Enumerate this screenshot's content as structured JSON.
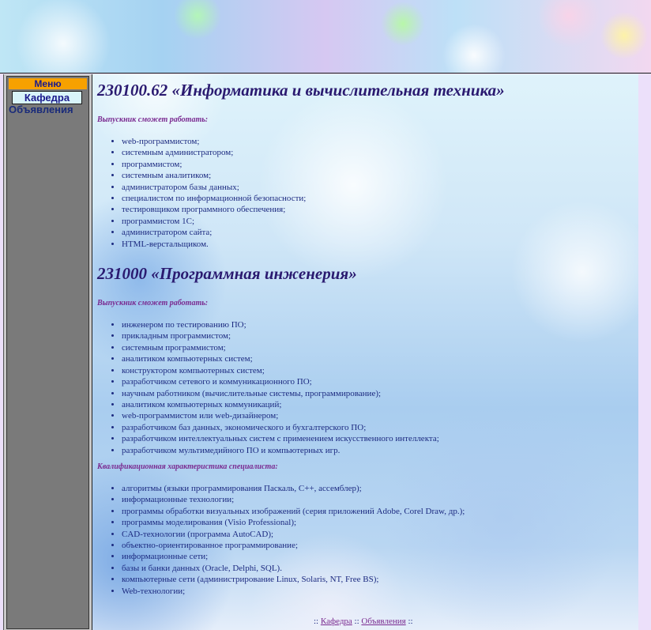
{
  "menu": {
    "title": "Меню",
    "items": [
      {
        "label": "Кафедра"
      },
      {
        "label": "Объявления"
      }
    ]
  },
  "sections": [
    {
      "heading": "230100.62 «Информатика и вычислительная техника»",
      "subheading": "Выпускник сможет работать:",
      "items": [
        "web-программистом;",
        "системным администратором;",
        "программистом;",
        "системным аналитиком;",
        "администратором базы данных;",
        "специалистом по информационной безопасности;",
        "тестировщиком программного обеспечения;",
        "программистом 1С;",
        "администратором сайта;",
        "HTML-верстальщиком."
      ]
    },
    {
      "heading": "231000 «Программная инженерия»",
      "subheading": "Выпускник сможет работать:",
      "items": [
        "инженером по тестированию ПО;",
        "прикладным программистом;",
        "системным программистом;",
        "аналитиком компьютерных систем;",
        "конструктором компьютерных систем;",
        "разработчиком сетевого и коммуникационного ПО;",
        "научным работником (вычислительные системы, программирование);",
        "аналитиком компьютерных коммуникаций;",
        "web-программистом или web-дизайнером;",
        "разработчиком баз данных, экономического и бухгалтерского ПО;",
        "разработчиком интеллектуальных систем с применением искусственного интеллекта;",
        "разработчиком мультимедийного ПО и компьютерных игр."
      ],
      "qualification_heading": "Квалификационная характеристика специалиста:",
      "qualification_items": [
        "алгоритмы (языки программирования Паскаль, С++, ассемблер);",
        "информационные технологии;",
        "программы обработки визуальных изображений (серия приложений Adobe, Corel Draw, др.);",
        "программы моделирования (Visio Professional);",
        "CAD-технологии (программа AutoCAD);",
        "объектно-ориентированное программирование;",
        "информационные сети;",
        "базы и банки данных (Oracle, Delphi, SQL).",
        "компьютерные сети (администрирование Linux, Solaris, NT, Free BS);",
        "Web-технологии;"
      ]
    }
  ],
  "footer": {
    "sep_start": ":: ",
    "link1": "Кафедра",
    "sep_mid": " :: ",
    "link2": "Объявления",
    "sep_end": " ::"
  }
}
